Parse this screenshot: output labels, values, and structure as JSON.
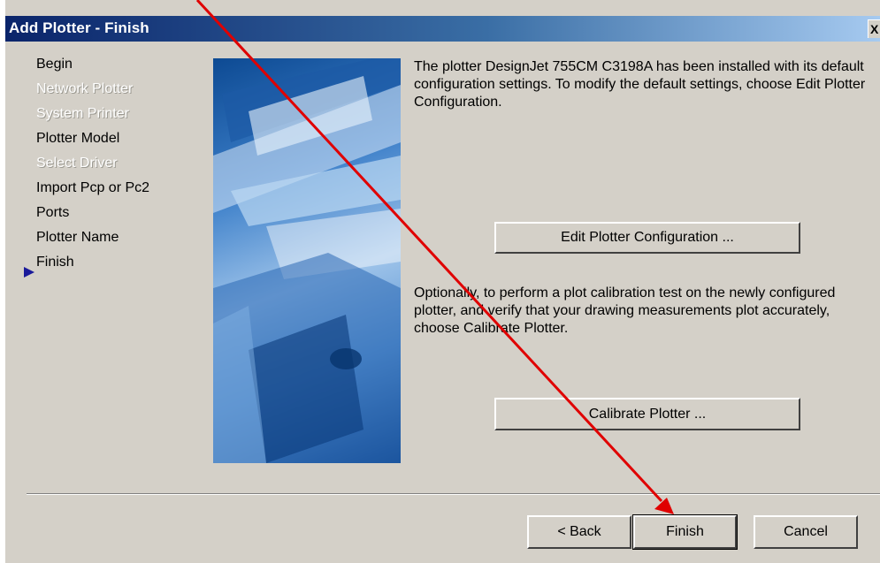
{
  "window": {
    "title": "Add Plotter - Finish",
    "close_glyph": "X"
  },
  "steps": [
    {
      "label": "Begin",
      "state": "enabled"
    },
    {
      "label": "Network Plotter",
      "state": "disabled"
    },
    {
      "label": "System Printer",
      "state": "disabled"
    },
    {
      "label": "Plotter Model",
      "state": "enabled"
    },
    {
      "label": "Select Driver",
      "state": "disabled"
    },
    {
      "label": "Import Pcp or Pc2",
      "state": "enabled"
    },
    {
      "label": "Ports",
      "state": "enabled"
    },
    {
      "label": "Plotter Name",
      "state": "enabled"
    },
    {
      "label": "Finish",
      "state": "current"
    }
  ],
  "content": {
    "installed_text": "The plotter DesignJet 755CM C3198A has been installed with its default configuration settings.  To modify the default settings, choose Edit Plotter Configuration.",
    "edit_config_label": "Edit Plotter Configuration ...",
    "calibrate_text": "Optionally, to perform a plot calibration test on the newly configured plotter, and verify that your drawing measurements plot accurately, choose Calibrate Plotter.",
    "calibrate_label": "Calibrate Plotter ..."
  },
  "footer": {
    "back_label": "< Back",
    "finish_label": "Finish",
    "cancel_label": "Cancel"
  },
  "colors": {
    "title_bar": "#0a246a",
    "dialog_bg": "#d4d0c8",
    "annotation_arrow": "#e00000"
  }
}
